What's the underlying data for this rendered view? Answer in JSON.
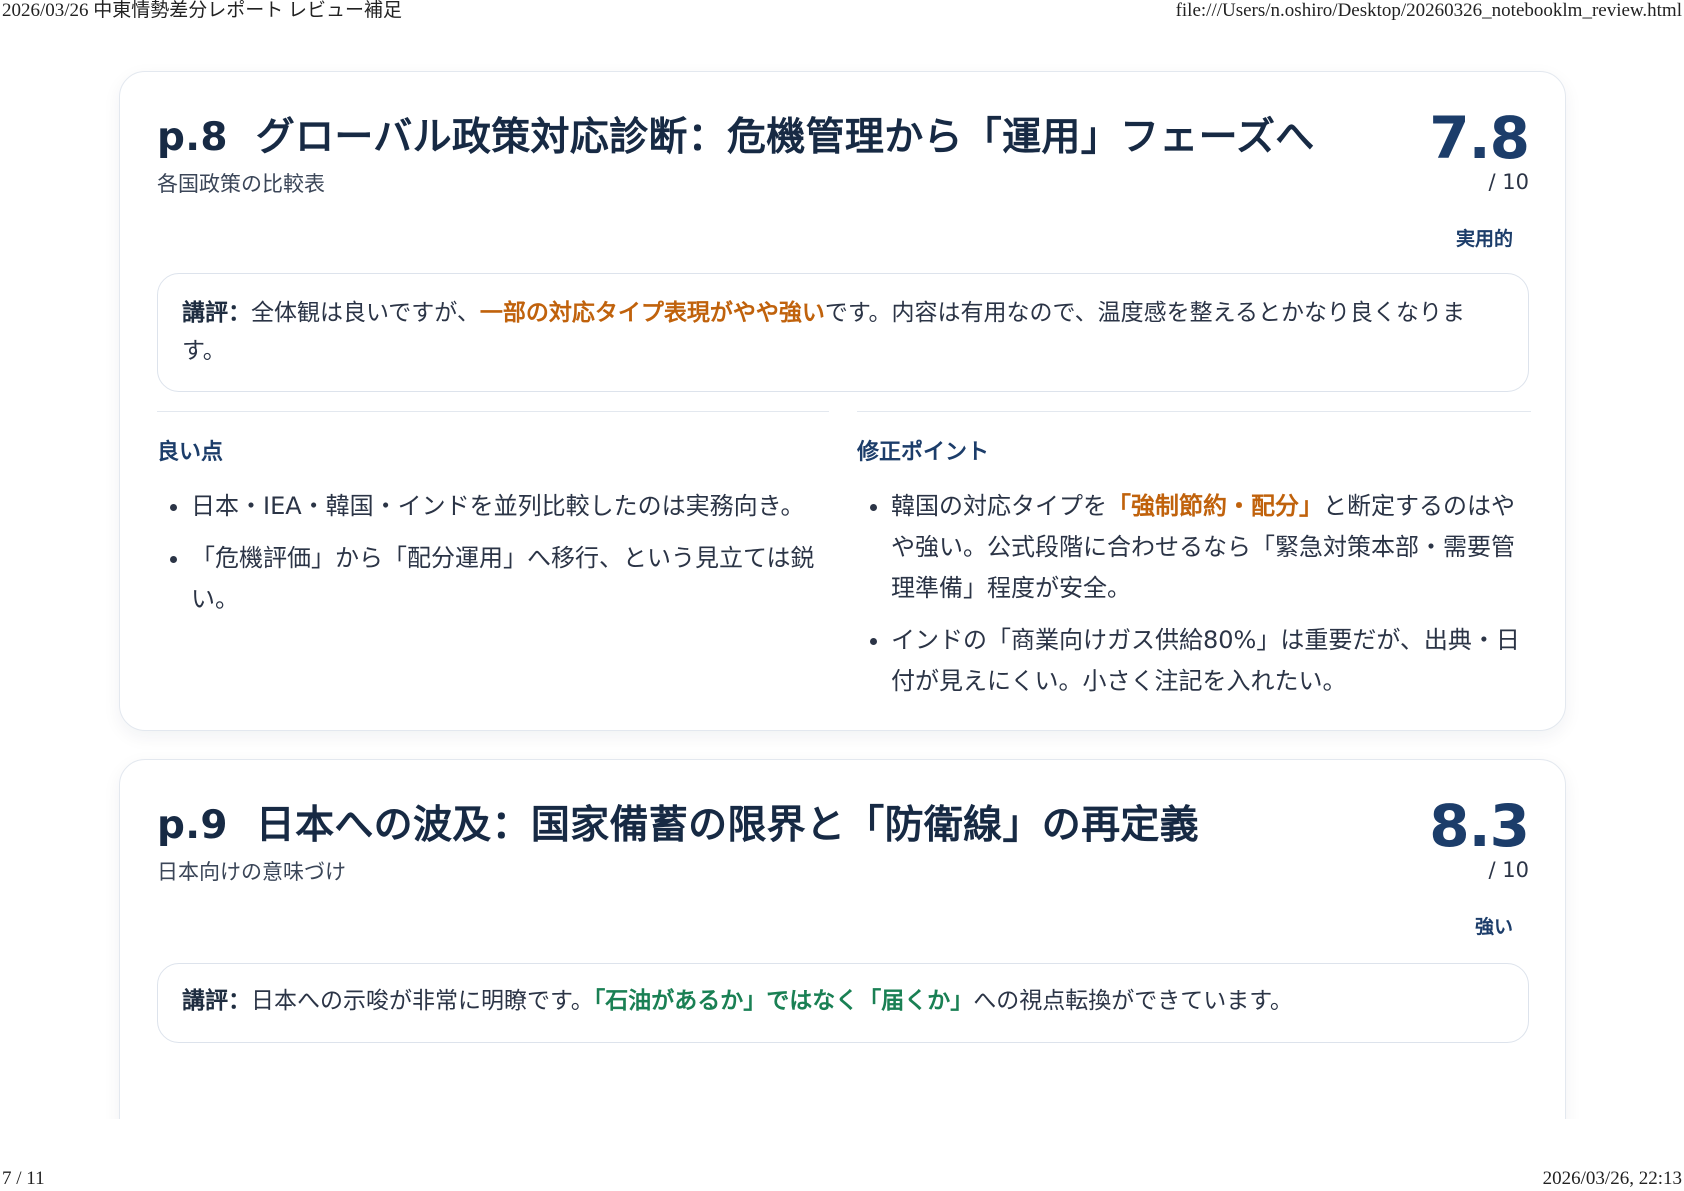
{
  "print_header": {
    "left": "2026/03/26 中東情勢差分レポート レビュー補足",
    "right": "file:///Users/n.oshiro/Desktop/20260326_notebooklm_review.html"
  },
  "print_footer": {
    "left": "7 / 11",
    "right": "2026/03/26, 22:13"
  },
  "cards": [
    {
      "page": "p.8",
      "title": "グローバル政策対応診断：危機管理から「運用」フェーズへ",
      "subtitle": "各国政策の比較表",
      "score": "7.8",
      "denom": "/ 10",
      "verdict": "実用的",
      "review": {
        "lead": "講評：",
        "pre": "全体観は良いですが、",
        "highlight": "一部の対応タイプ表現がやや強い",
        "post": "です。内容は有用なので、温度感を整えるとかなり良くなります。"
      },
      "good_title": "良い点",
      "good": [
        "日本・IEA・韓国・インドを並列比較したのは実務向き。",
        "「危機評価」から「配分運用」へ移行、という見立ては鋭い。"
      ],
      "fix_title": "修正ポイント",
      "fix": [
        {
          "pre": "韓国の対応タイプを",
          "highlight": "「強制節約・配分」",
          "post": "と断定するのはやや強い。公式段階に合わせるなら「緊急対策本部・需要管理準備」程度が安全。"
        },
        {
          "pre": "インドの「商業向けガス供給80%」は重要だが、出典・日付が見えにくい。小さく注記を入れたい。",
          "highlight": "",
          "post": ""
        }
      ]
    },
    {
      "page": "p.9",
      "title": "日本への波及：国家備蓄の限界と「防衛線」の再定義",
      "subtitle": "日本向けの意味づけ",
      "score": "8.3",
      "denom": "/ 10",
      "verdict": "強い",
      "review": {
        "lead": "講評：",
        "pre": "日本への示唆が非常に明瞭です。",
        "highlight": "「石油があるか」ではなく「届くか」",
        "post": "への視点転換ができています。"
      }
    }
  ]
}
